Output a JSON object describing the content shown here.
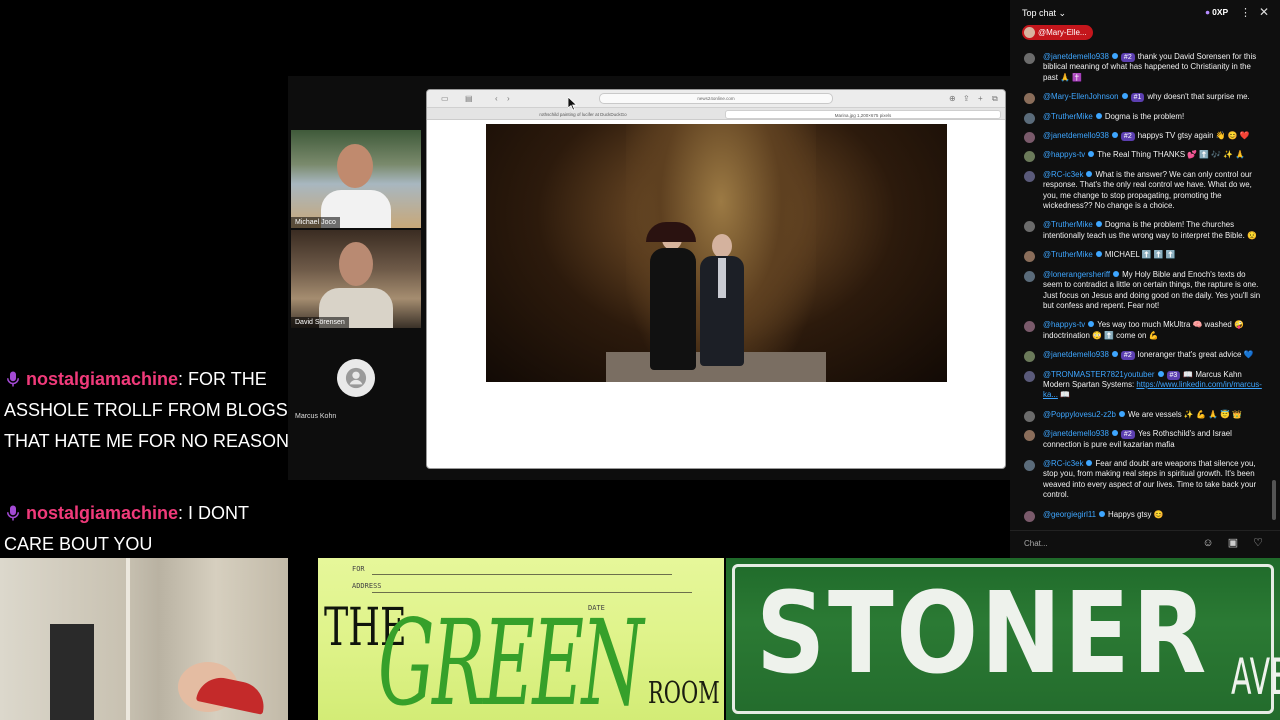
{
  "overlay_messages": [
    {
      "user": "nostalgiamachine",
      "text": ": FOR THE ASSHOLE TROLLF FROM BLOGS THAT HATE ME FOR NO REASON"
    },
    {
      "user": "nostalgiamachine",
      "text": ": I DONT CARE BOUT YOU"
    }
  ],
  "meeting": {
    "participants": [
      {
        "name": "Michael Joco"
      },
      {
        "name": "David Sörensen"
      },
      {
        "name": "Marcus Kohn"
      }
    ],
    "browser": {
      "url": "news24online.com",
      "tabs": [
        "rothschild painting of lucifer at DuckDuckGo",
        "Marina.jpg 1,200×675 pixels"
      ]
    }
  },
  "chat": {
    "title": "Top chat",
    "xp": "0XP",
    "pinned_user": "@Mary-Elle...",
    "messages": [
      {
        "user": "@janetdemello938",
        "badge": "#2",
        "text": "thank you David Sorensen for this biblical meaning of what has happened to Christianity in the past 🙏 ✝️"
      },
      {
        "user": "@Mary-EllenJohnson",
        "badge": "#1",
        "text": "why doesn't that surprise me."
      },
      {
        "user": "@TrutherMike",
        "badge": "",
        "text": "Dogma is the problem!"
      },
      {
        "user": "@janetdemello938",
        "badge": "#2",
        "text": "happys TV gtsy again 👋 😊 ❤️"
      },
      {
        "user": "@happys-tv",
        "badge": "",
        "text": "The Real Thing THANKS 💕 ⬆️ 🎶 ✨ 🙏"
      },
      {
        "user": "@RC-ic3ek",
        "badge": "",
        "text": "What is the answer? We can only control our response. That's the only real control we have. What do we, you, me change to stop propagating, promoting the wickedness?? No change is a choice."
      },
      {
        "user": "@TrutherMike",
        "badge": "",
        "text": "Dogma is the problem! The churches intentionally teach us the wrong way to interpret the Bible. 😟"
      },
      {
        "user": "@TrutherMike",
        "badge": "",
        "text": "MICHAEL ⬆️ ⬆️ ⬆️"
      },
      {
        "user": "@lonerangersheriff",
        "badge": "",
        "text": "My Holy Bible and Enoch's texts do seem to contradict a little on certain things, the rapture is one. Just focus on Jesus and doing good on the daily. Yes you'll sin but confess and repent. Fear not!"
      },
      {
        "user": "@happys-tv",
        "badge": "",
        "text": "Yes way too much MkUltra 🧠 washed 🤪 indoctrination 😳 ⬆️ come on 💪"
      },
      {
        "user": "@janetdemello938",
        "badge": "#2",
        "text": "loneranger that's great advice 💙"
      },
      {
        "user": "@TRONMASTER7821youtuber",
        "badge": "#3",
        "text": "📖 Marcus Kahn Modern Spartan Systems: ",
        "link": "https://www.linkedin.com/in/marcus-ka...",
        "after": " 📖"
      },
      {
        "user": "@Poppylovesu2-z2b",
        "badge": "",
        "text": "We are vessels ✨ 💪 🙏 😇 👑"
      },
      {
        "user": "@janetdemello938",
        "badge": "#2",
        "text": "Yes Rothschild's and Israel connection is pure evil kazarian mafia"
      },
      {
        "user": "@RC-ic3ek",
        "badge": "",
        "text": "Fear and doubt are weapons that silence you, stop you, from making real steps in spiritual growth. It's been weaved into every aspect of our lives. Time to take back your control."
      },
      {
        "user": "@georgiegirl11",
        "badge": "",
        "text": "Happys gtsy 😊"
      }
    ],
    "input_placeholder": "Chat..."
  },
  "banners": {
    "green_room": {
      "the": "THE",
      "green": "GREEN",
      "room": "ROOM",
      "for": "FOR",
      "address": "ADDRESS",
      "date": "DATE"
    },
    "stoner": {
      "main": "STONER",
      "suffix": "AVE"
    }
  },
  "colors": {
    "overlay_user": "#f03a7a",
    "chat_name": "#3ea6ff",
    "pinned_bg": "#c4161c",
    "stoner_green": "#2b7a34",
    "green_room_bg": "#dff38a"
  },
  "icons": {
    "mic": "microphone-icon",
    "more": "more-vert-icon",
    "close": "close-icon",
    "emoji": "emoji-icon",
    "gift": "gift-icon",
    "heart": "heart-icon"
  }
}
